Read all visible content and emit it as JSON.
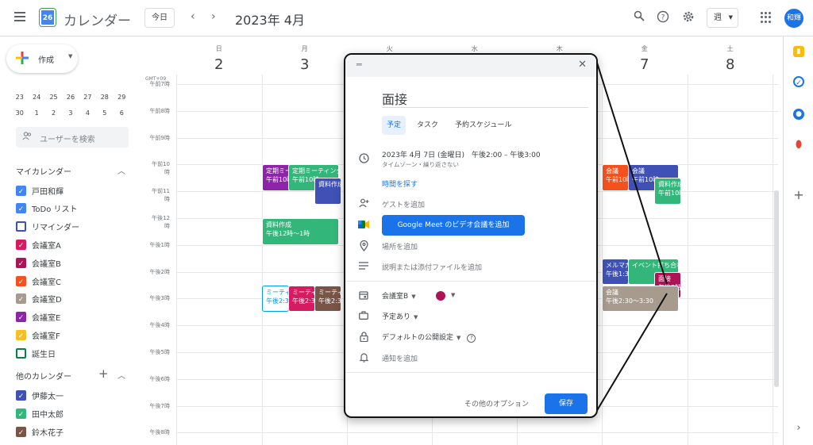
{
  "header": {
    "logo_day": "26",
    "app_title": "カレンダー",
    "today_label": "今日",
    "month_title": "2023年 4月",
    "view_label": "週",
    "avatar_text": "和輝"
  },
  "sidebar": {
    "create_label": "作成",
    "mini_cal_rows": [
      [
        "23",
        "24",
        "25",
        "26",
        "27",
        "28",
        "29"
      ],
      [
        "30",
        "1",
        "2",
        "3",
        "4",
        "5",
        "6"
      ]
    ],
    "user_search_placeholder": "ユーザーを検索",
    "my_calendars_title": "マイカレンダー",
    "my_calendars": [
      {
        "name": "戸田和輝",
        "color": "#4285f4",
        "checked": true
      },
      {
        "name": "ToDo リスト",
        "color": "#4285f4",
        "checked": true
      },
      {
        "name": "リマインダー",
        "color": "#3f51b5",
        "checked": false
      },
      {
        "name": "会議室A",
        "color": "#d81b60",
        "checked": true
      },
      {
        "name": "会議室B",
        "color": "#ad1457",
        "checked": true
      },
      {
        "name": "会議室C",
        "color": "#f4511e",
        "checked": true
      },
      {
        "name": "会議室D",
        "color": "#a79b8e",
        "checked": true
      },
      {
        "name": "会議室E",
        "color": "#8e24aa",
        "checked": true
      },
      {
        "name": "会議室F",
        "color": "#f6bf26",
        "checked": true
      },
      {
        "name": "誕生日",
        "color": "#0b8043",
        "checked": false
      }
    ],
    "other_calendars_title": "他のカレンダー",
    "other_calendars": [
      {
        "name": "伊藤太一",
        "color": "#3f51b5",
        "checked": true
      },
      {
        "name": "田中太郎",
        "color": "#33b679",
        "checked": true
      },
      {
        "name": "鈴木花子",
        "color": "#795548",
        "checked": true
      }
    ]
  },
  "calendar": {
    "timezone": "GMT+09",
    "days": [
      {
        "dow": "日",
        "num": "2"
      },
      {
        "dow": "月",
        "num": "3"
      },
      {
        "dow": "火",
        "num": ""
      },
      {
        "dow": "水",
        "num": ""
      },
      {
        "dow": "木",
        "num": ""
      },
      {
        "dow": "金",
        "num": "7"
      },
      {
        "dow": "土",
        "num": "8"
      }
    ],
    "hours": [
      "午前7時",
      "午前8時",
      "午前9時",
      "午前10時",
      "午前11時",
      "午後12時",
      "午後1時",
      "午後2時",
      "午後3時",
      "午後4時",
      "午後5時",
      "午後6時",
      "午後7時",
      "午後8時"
    ],
    "events": [
      {
        "day": 1,
        "start": 10,
        "end": 11,
        "col": 0,
        "cols": 2,
        "title": "定期ミーティング",
        "time": "午前10時",
        "color": "#8e24aa"
      },
      {
        "day": 1,
        "start": 10,
        "end": 11,
        "col": 1,
        "cols": 2,
        "title": "定期ミーティング",
        "time": "午前10時",
        "color": "#33b679"
      },
      {
        "day": 1,
        "start": 10.5,
        "end": 11.5,
        "col": 2,
        "cols": 3,
        "title": "資料作成",
        "time": "",
        "color": "#3f51b5"
      },
      {
        "day": 1,
        "start": 12,
        "end": 13,
        "col": 0,
        "cols": 1,
        "title": "資料作成",
        "time": "午後12時〜1時",
        "color": "#33b679"
      },
      {
        "day": 1,
        "start": 14.5,
        "end": 15.5,
        "col": 0,
        "cols": 3,
        "title": "ミーティング",
        "time": "午後2:30",
        "color": "#ffffff",
        "outline": "#039be5"
      },
      {
        "day": 1,
        "start": 14.5,
        "end": 15.5,
        "col": 1,
        "cols": 3,
        "title": "ミーティング",
        "time": "午後2:30",
        "color": "#d81b60"
      },
      {
        "day": 1,
        "start": 14.5,
        "end": 15.5,
        "col": 2,
        "cols": 3,
        "title": "ミーティング",
        "time": "午後2:30",
        "color": "#795548"
      },
      {
        "day": 5,
        "start": 10,
        "end": 11,
        "col": 0,
        "cols": 3,
        "title": "会議",
        "time": "午前10時",
        "color": "#f4511e"
      },
      {
        "day": 5,
        "start": 10,
        "end": 11,
        "col": 1,
        "cols": 2,
        "title": "会議",
        "time": "午前10時",
        "color": "#3f51b5"
      },
      {
        "day": 5,
        "start": 10.5,
        "end": 11.5,
        "col": 2,
        "cols": 3,
        "title": "資料作成",
        "time": "午前10時",
        "color": "#33b679"
      },
      {
        "day": 5,
        "start": 13.5,
        "end": 14.5,
        "col": 0,
        "cols": 3,
        "title": "メルマガ作成",
        "time": "午後1:30",
        "color": "#3f51b5"
      },
      {
        "day": 5,
        "start": 13.5,
        "end": 14.5,
        "col": 1,
        "cols": 2,
        "title": "イベント打ち合わせ",
        "time": "",
        "color": "#33b679"
      },
      {
        "day": 5,
        "start": 14,
        "end": 15,
        "col": 2,
        "cols": 3,
        "title": "面接",
        "time": "午後2時",
        "color": "#ad1457"
      },
      {
        "day": 5,
        "start": 14.5,
        "end": 15.5,
        "col": 0,
        "cols": 1,
        "title": "会議",
        "time": "午後2:30〜3:30",
        "color": "#a79b8e"
      }
    ]
  },
  "popup": {
    "title": "面接",
    "tabs": [
      "予定",
      "タスク",
      "予約スケジュール"
    ],
    "datetime": "2023年 4月 7日 (金曜日)　午後2:00 – 午後3:00",
    "datetime_sub": "タイムゾーン・繰り返さない",
    "find_time": "時間を探す",
    "add_guests": "ゲストを追加",
    "meet_button": "Google Meet のビデオ会議を追加",
    "add_location": "場所を追加",
    "add_description": "説明または添付ファイルを追加",
    "calendar_name": "会議室B",
    "calendar_color": "#ad1457",
    "availability": "予定あり",
    "visibility": "デフォルトの公開設定",
    "notification": "通知を追加",
    "more_options": "その他のオプション",
    "save": "保存"
  }
}
